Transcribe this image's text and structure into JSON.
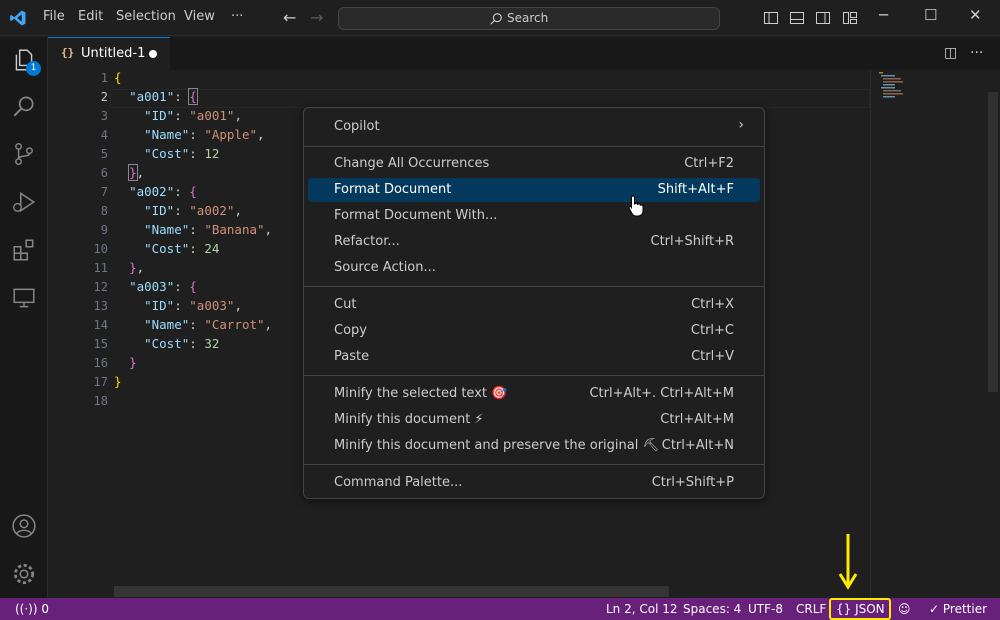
{
  "titlebar": {
    "menus": [
      "File",
      "Edit",
      "Selection",
      "View",
      "···"
    ],
    "search_placeholder": "Search"
  },
  "activity": {
    "explorer_badge": "1"
  },
  "tab": {
    "label": "Untitled-1",
    "icon_text": "{}"
  },
  "editor": {
    "line_numbers": [
      "1",
      "2",
      "3",
      "4",
      "5",
      "6",
      "7",
      "8",
      "9",
      "10",
      "11",
      "12",
      "13",
      "14",
      "15",
      "16",
      "17",
      "18"
    ],
    "active_line": "2"
  },
  "context_menu": {
    "items": [
      {
        "label": "Copilot",
        "shortcut": "",
        "submenu": true
      },
      {
        "label": "Change All Occurrences",
        "shortcut": "Ctrl+F2"
      },
      {
        "label": "Format Document",
        "shortcut": "Shift+Alt+F",
        "selected": true
      },
      {
        "label": "Format Document With...",
        "shortcut": ""
      },
      {
        "label": "Refactor...",
        "shortcut": "Ctrl+Shift+R"
      },
      {
        "label": "Source Action...",
        "shortcut": ""
      },
      {
        "label": "Cut",
        "shortcut": "Ctrl+X"
      },
      {
        "label": "Copy",
        "shortcut": "Ctrl+C"
      },
      {
        "label": "Paste",
        "shortcut": "Ctrl+V"
      },
      {
        "label": "Minify the selected text 🎯",
        "shortcut": "Ctrl+Alt+. Ctrl+Alt+M"
      },
      {
        "label": "Minify this document ⚡",
        "shortcut": "Ctrl+Alt+M"
      },
      {
        "label": "Minify this document and preserve the original ⛏",
        "shortcut": "Ctrl+Alt+N"
      },
      {
        "label": "Command Palette...",
        "shortcut": "Ctrl+Shift+P"
      }
    ]
  },
  "statusbar": {
    "remote_count": "0",
    "cursor": "Ln 2, Col 12",
    "spaces": "Spaces: 4",
    "encoding": "UTF-8",
    "eol": "CRLF",
    "language": "{} JSON",
    "prettier": "✓ Prettier"
  },
  "colors": {
    "statusbar_bg": "#68217a",
    "selection_bg": "#04395e",
    "annotation": "#ffea00"
  }
}
